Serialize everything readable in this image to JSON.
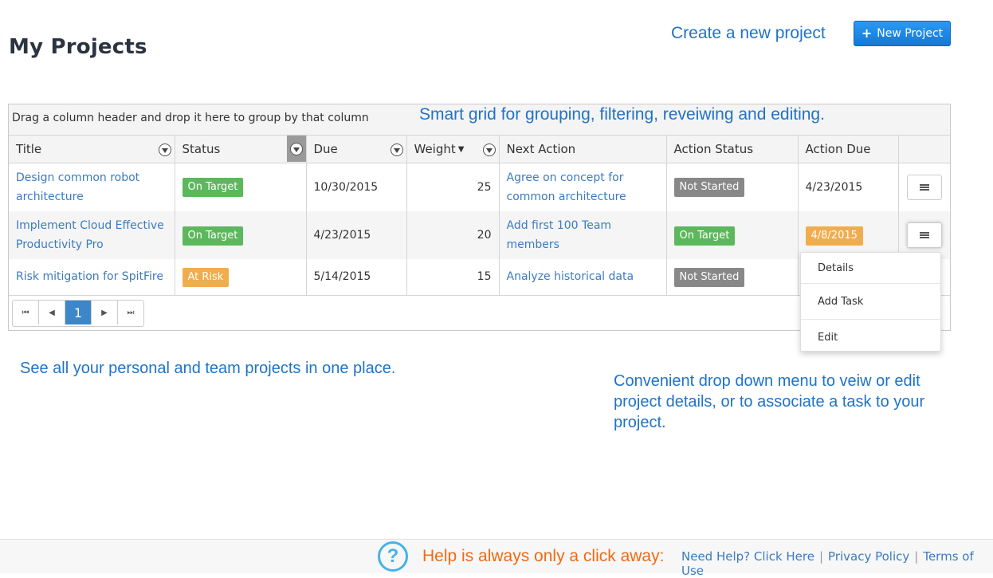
{
  "page": {
    "title": "My Projects"
  },
  "annotations": {
    "create": "Create a new project",
    "grid": "Smart grid for grouping, filtering, reveiwing and editing.",
    "see_all": "See all your personal and team projects in one place.",
    "dropdown": "Convenient drop down menu to veiw or edit project details, or to associate a task to your project."
  },
  "toolbar": {
    "new_project_label": "New Project"
  },
  "grid": {
    "group_hint": "Drag a column header and drop it here to group by that column",
    "columns": [
      "Title",
      "Status",
      "Due",
      "Weight",
      "Next Action",
      "Action Status",
      "Action Due"
    ],
    "rows": [
      {
        "title": "Design common robot architecture",
        "status": "On Target",
        "status_color": "#5cb85c",
        "due": "10/30/2015",
        "weight": "25",
        "next_action": "Agree on concept for common architecture",
        "action_status": "Not Started",
        "action_status_color": "#888888",
        "action_due": "4/23/2015",
        "action_due_highlight": ""
      },
      {
        "title": "Implement Cloud Effective Productivity Pro",
        "status": "On Target",
        "status_color": "#5cb85c",
        "due": "4/23/2015",
        "weight": "20",
        "next_action": "Add first 100 Team members",
        "action_status": "On Target",
        "action_status_color": "#5cb85c",
        "action_due": "4/8/2015",
        "action_due_highlight": "#f0ad4e"
      },
      {
        "title": "Risk mitigation for SpitFire",
        "status": "At Risk",
        "status_color": "#f0ad4e",
        "due": "5/14/2015",
        "weight": "15",
        "next_action": "Analyze historical data",
        "action_status": "Not Started",
        "action_status_color": "#888888",
        "action_due": "",
        "action_due_highlight": ""
      }
    ],
    "pager": {
      "first": "⏮",
      "prev": "◀",
      "current": "1",
      "next": "▶",
      "last": "⏭"
    }
  },
  "row_menu": {
    "items": [
      "Details",
      "Add Task",
      "Edit"
    ]
  },
  "footer": {
    "help_icon": "question-icon",
    "help_glyph": "?",
    "help_text": "Help is always only a click away:",
    "links": [
      "Need Help? Click Here",
      "Privacy Policy",
      "Terms of Use"
    ],
    "separator": "|"
  },
  "colors": {
    "accent": "#1f73c7",
    "link": "#3b7bbf",
    "help_orange": "#f06a12",
    "help_blue": "#47b2e8"
  }
}
